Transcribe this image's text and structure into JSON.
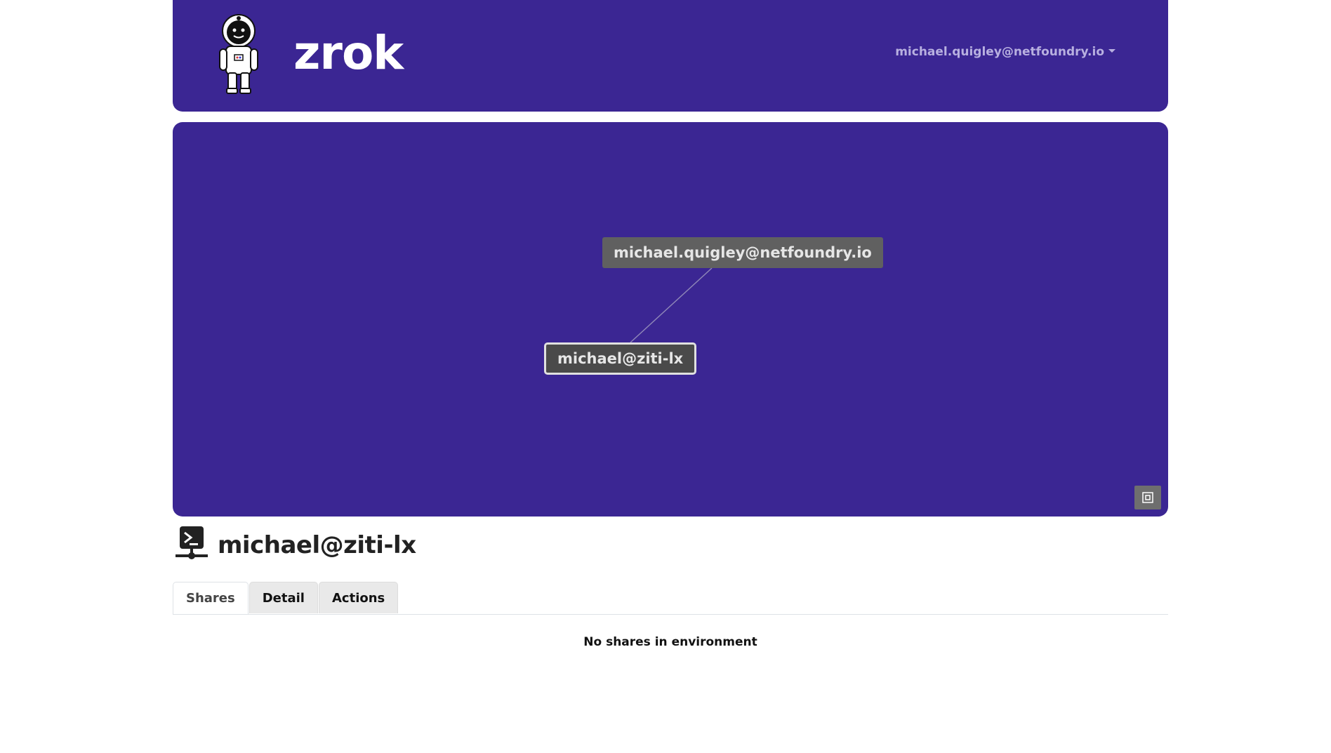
{
  "header": {
    "brand": "zrok",
    "user_email": "michael.quigley@netfoundry.io"
  },
  "graph": {
    "account_node": "michael.quigley@netfoundry.io",
    "environment_node": "michael@ziti-lx",
    "fit_icon": "fit-view-icon"
  },
  "environment": {
    "icon": "terminal-network-icon",
    "title": "michael@ziti-lx"
  },
  "tabs": [
    {
      "label": "Shares",
      "active": true
    },
    {
      "label": "Detail",
      "active": false
    },
    {
      "label": "Actions",
      "active": false
    }
  ],
  "shares": {
    "empty_message": "No shares in environment"
  },
  "colors": {
    "primary": "#3b2693",
    "node_account": "#606060",
    "node_environment": "#4a4a4a"
  }
}
